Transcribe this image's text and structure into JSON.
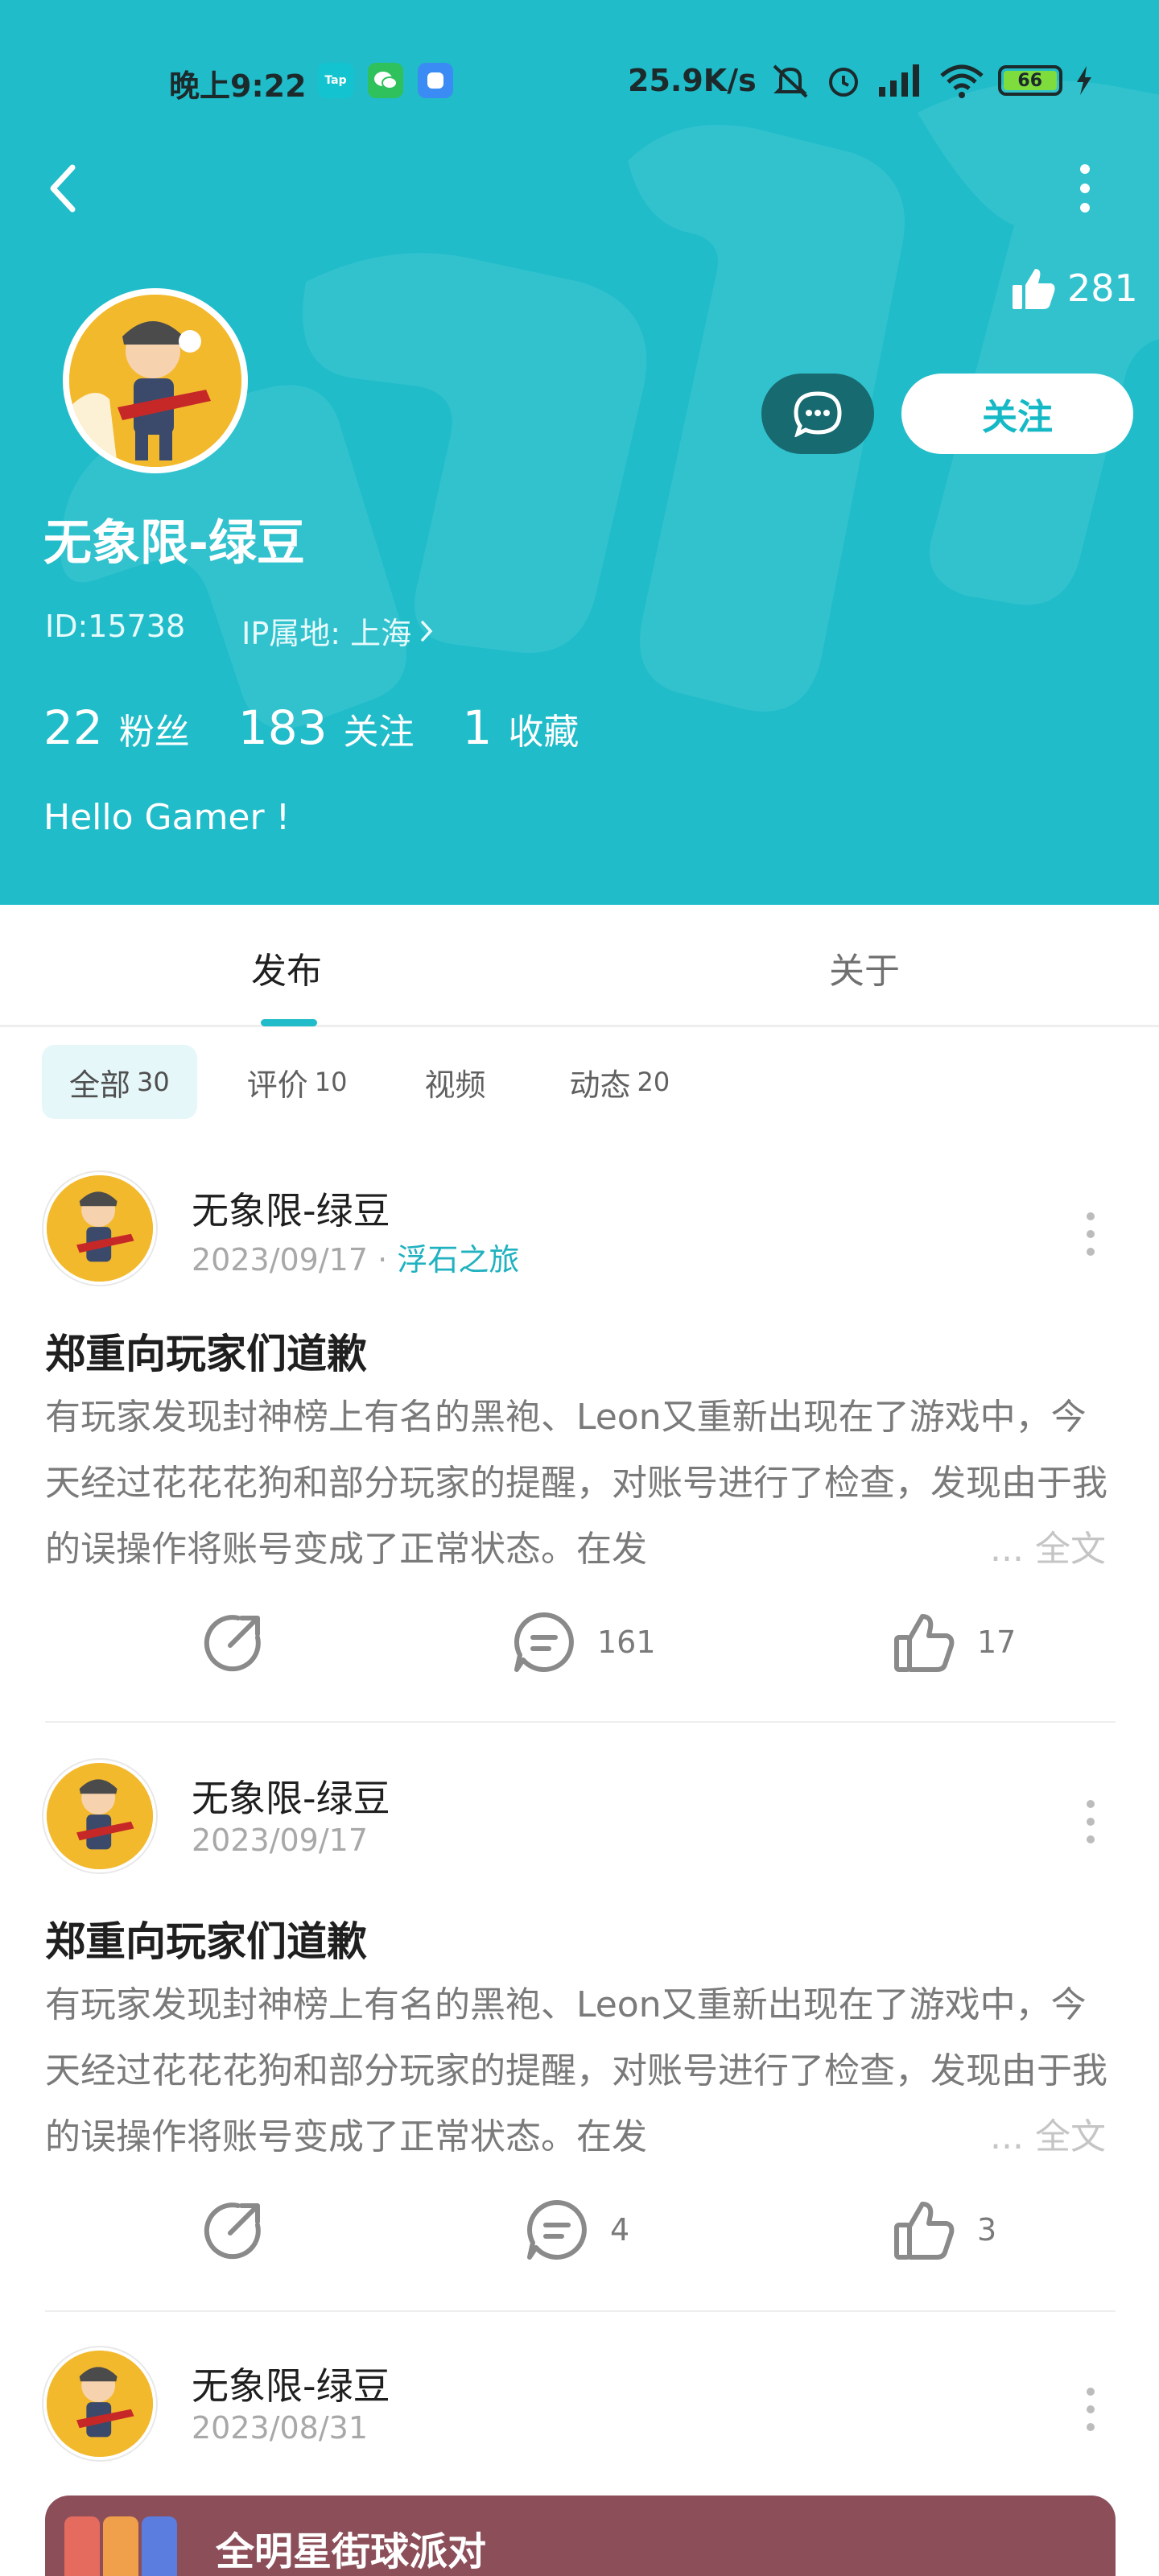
{
  "status_bar": {
    "time": "晚上9:22",
    "app_badge": "Tap",
    "net_speed": "25.9K/s",
    "battery": "66"
  },
  "profile": {
    "likes": "281",
    "follow_label": "关注",
    "name": "无象限-绿豆",
    "id_text": "ID:15738",
    "ip_text": "IP属地: 上海",
    "stats": [
      {
        "num": "22",
        "label": "粉丝"
      },
      {
        "num": "183",
        "label": "关注"
      },
      {
        "num": "1",
        "label": "收藏"
      }
    ],
    "bio": "Hello Gamer !"
  },
  "tabs": [
    "发布",
    "关于"
  ],
  "filters": [
    {
      "label": "全部",
      "count": "30"
    },
    {
      "label": "评价",
      "count": "10"
    },
    {
      "label": "视频",
      "count": ""
    },
    {
      "label": "动态",
      "count": "20"
    }
  ],
  "posts": [
    {
      "author": "无象限-绿豆",
      "date": "2023/09/17",
      "sep": "·",
      "game": "浮石之旅",
      "title": "郑重向玩家们道歉",
      "body": "有玩家发现封神榜上有名的黑袍、Leon又重新出现在了游戏中，今天经过花花花狗和部分玩家的提醒，对账号进行了检查，发现由于我的误操作将账号变成了正常状态。在发",
      "more_text": "... 全文",
      "comments": "161",
      "likes": "17"
    },
    {
      "author": "无象限-绿豆",
      "date": "2023/09/17",
      "title": "郑重向玩家们道歉",
      "body": "有玩家发现封神榜上有名的黑袍、Leon又重新出现在了游戏中，今天经过花花花狗和部分玩家的提醒，对账号进行了检查，发现由于我的误操作将账号变成了正常状态。在发",
      "more_text": "... 全文",
      "comments": "4",
      "likes": "3"
    },
    {
      "author": "无象限-绿豆",
      "date": "2023/08/31",
      "game_card_title": "全明星街球派对"
    }
  ]
}
